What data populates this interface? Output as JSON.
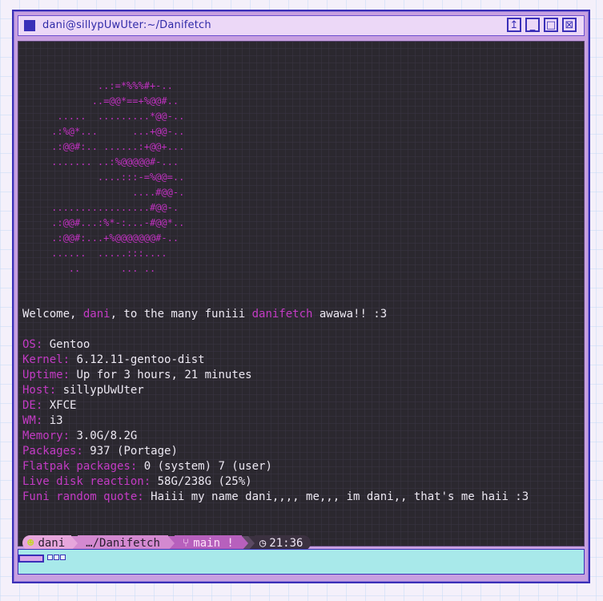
{
  "window": {
    "title": "dani@sillypUwUter:~/Danifetch",
    "buttons": [
      "↥",
      "_",
      "□",
      "⊠"
    ]
  },
  "terminal": {
    "ascii_art": "             ..:=*%%%#+-..\n            ..=@@*==+%@@#..\n      .....  .........*@@-..\n     .:%@*...      ...+@@-..\n     .:@@#:.. ......:+@@+...\n     ....... ..:%@@@@@#-...\n             ....:::-=%@@=..\n                   ....#@@-.\n     .................#@@-.\n     .:@@#...:%*-:...-#@@*..\n     .:@@#:...+%@@@@@@@#-..\n     ......  .....:::....\n        ..       ... ..",
    "welcome": {
      "pre": "Welcome, ",
      "name": "dani",
      "mid": ", to the many funiii ",
      "app": "danifetch",
      "post": " awawa!! :3"
    },
    "info": [
      {
        "key": "OS:",
        "value": "Gentoo"
      },
      {
        "key": "Kernel:",
        "value": "6.12.11-gentoo-dist"
      },
      {
        "key": "Uptime:",
        "value": "Up for 3 hours, 21 minutes"
      },
      {
        "key": "Host:",
        "value": "sillypUwUter"
      },
      {
        "key": "DE:",
        "value": "XFCE"
      },
      {
        "key": "WM:",
        "value": "i3"
      },
      {
        "key": "Memory:",
        "value": "3.0G/8.2G"
      },
      {
        "key": "Packages:",
        "value": "937 (Portage)"
      },
      {
        "key": "Flatpak packages:",
        "value": "0 (system) 7 (user)"
      },
      {
        "key": "Live disk reaction:",
        "value": "58G/238G (25%)"
      },
      {
        "key": "Funi random quote:",
        "value": "Haiii my name dani,,,, me,,, im dani,, that's me haii :3"
      }
    ],
    "prompt": {
      "user_icon": "☻",
      "user": "dani",
      "path": "…/Danifetch",
      "branch_icon": "⑂",
      "branch": "main !",
      "clock_icon": "◷",
      "time": "21:36",
      "caret": "➜"
    }
  },
  "colors": {
    "accent": "#c33bc4",
    "terminal_bg": "#2b282f",
    "frame": "#3a2fb8",
    "statusbar": "#a8e9ea"
  }
}
